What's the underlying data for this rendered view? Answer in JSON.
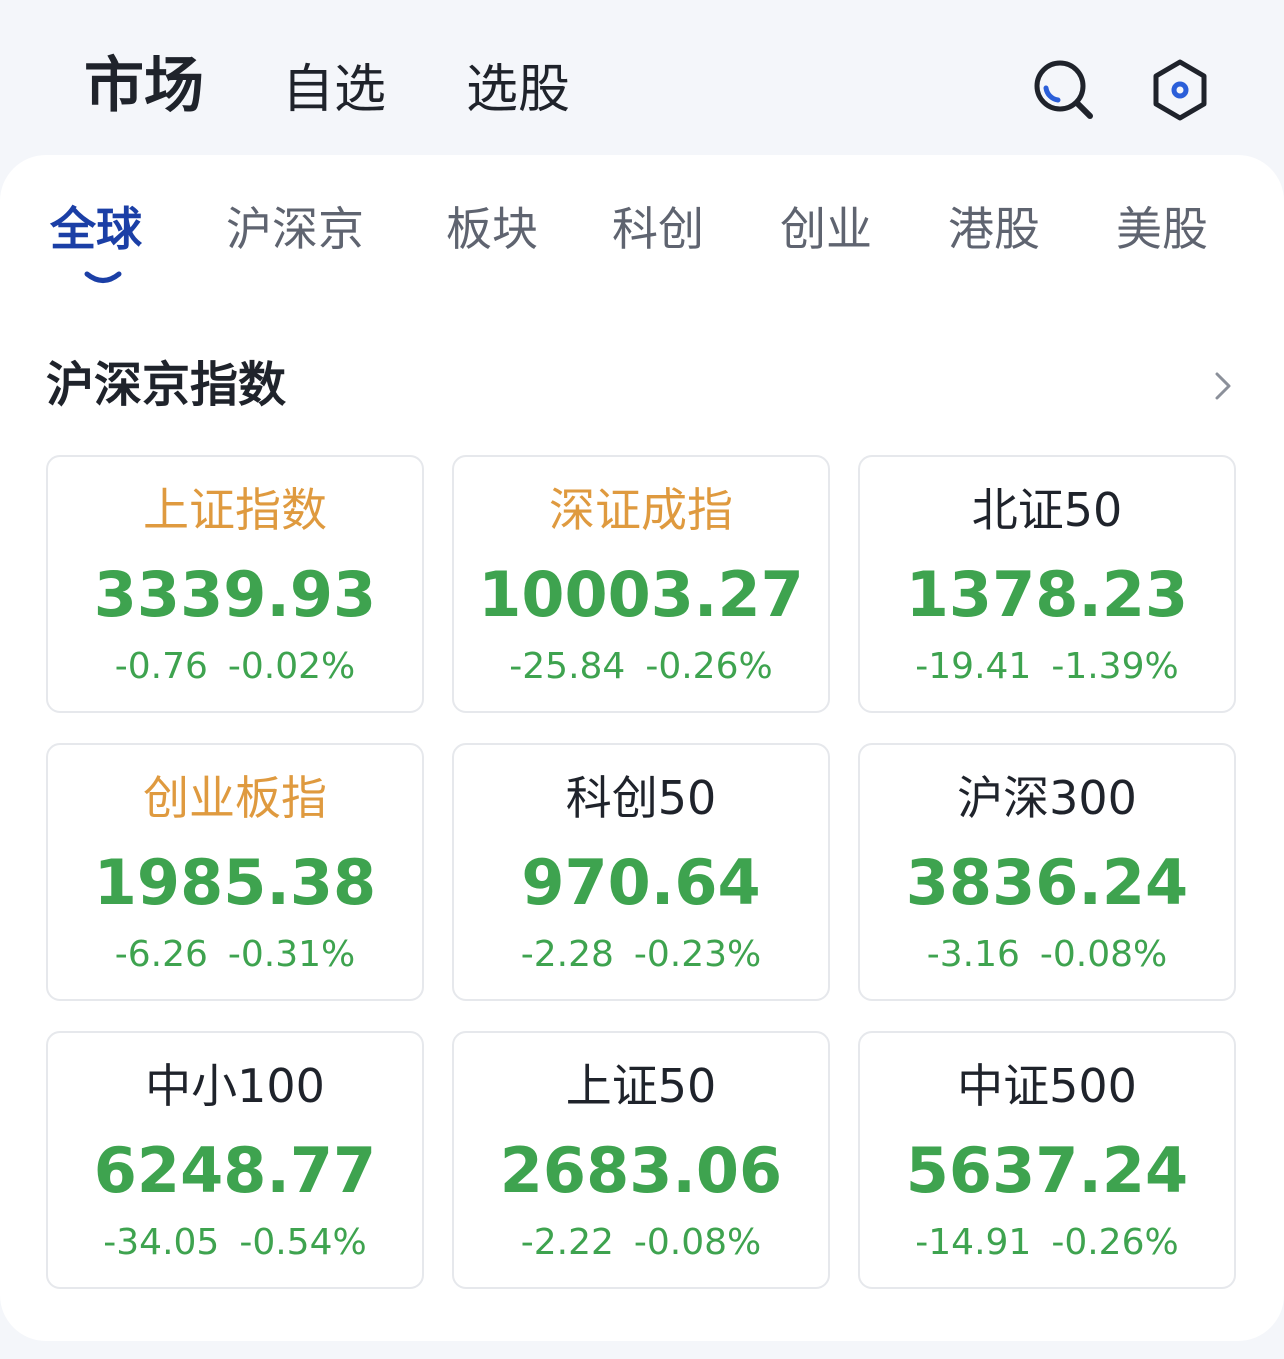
{
  "header": {
    "tabs": [
      {
        "label": "市场",
        "active": true
      },
      {
        "label": "自选",
        "active": false
      },
      {
        "label": "选股",
        "active": false
      }
    ],
    "icons": [
      "search-icon",
      "settings-icon"
    ]
  },
  "categories": {
    "tabs": [
      {
        "label": "全球",
        "active": true
      },
      {
        "label": "沪深京",
        "active": false
      },
      {
        "label": "板块",
        "active": false
      },
      {
        "label": "科创",
        "active": false
      },
      {
        "label": "创业",
        "active": false
      },
      {
        "label": "港股",
        "active": false
      },
      {
        "label": "美股",
        "active": false
      }
    ]
  },
  "section": {
    "title": "沪深京指数"
  },
  "indices": [
    {
      "name": "上证指数",
      "value": "3339.93",
      "change": "-0.76",
      "pct": "-0.02%",
      "highlight": true
    },
    {
      "name": "深证成指",
      "value": "10003.27",
      "change": "-25.84",
      "pct": "-0.26%",
      "highlight": true
    },
    {
      "name": "北证50",
      "value": "1378.23",
      "change": "-19.41",
      "pct": "-1.39%",
      "highlight": false
    },
    {
      "name": "创业板指",
      "value": "1985.38",
      "change": "-6.26",
      "pct": "-0.31%",
      "highlight": true
    },
    {
      "name": "科创50",
      "value": "970.64",
      "change": "-2.28",
      "pct": "-0.23%",
      "highlight": false
    },
    {
      "name": "沪深300",
      "value": "3836.24",
      "change": "-3.16",
      "pct": "-0.08%",
      "highlight": false
    },
    {
      "name": "中小100",
      "value": "6248.77",
      "change": "-34.05",
      "pct": "-0.54%",
      "highlight": false
    },
    {
      "name": "上证50",
      "value": "2683.06",
      "change": "-2.22",
      "pct": "-0.08%",
      "highlight": false
    },
    {
      "name": "中证500",
      "value": "5637.24",
      "change": "-14.91",
      "pct": "-0.26%",
      "highlight": false
    }
  ],
  "colors": {
    "down": "#3ea34f",
    "highlight_name": "#df9a3f",
    "active_tab": "#1b3fa6",
    "page_bg": "#f4f6fa"
  }
}
